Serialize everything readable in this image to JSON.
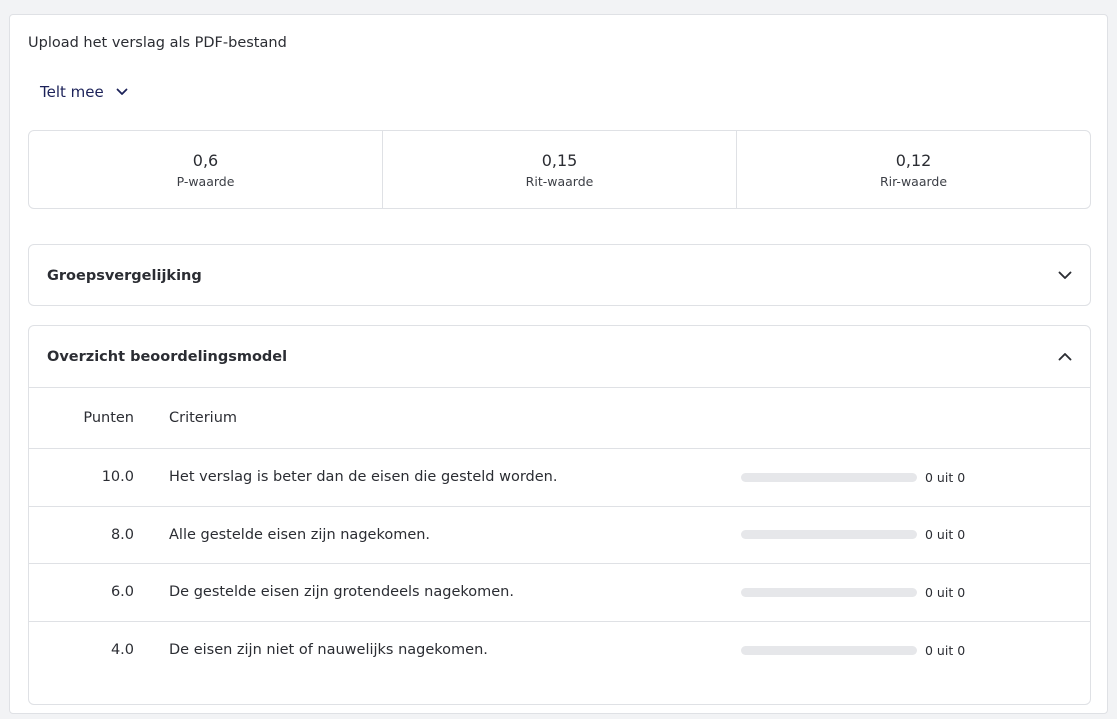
{
  "instruction": "Upload het verslag als PDF-bestand",
  "counts_toggle": {
    "label": "Telt mee",
    "icon": "chevron-down-icon"
  },
  "stats": [
    {
      "value": "0,6",
      "label": "P-waarde"
    },
    {
      "value": "0,15",
      "label": "Rit-waarde"
    },
    {
      "value": "0,12",
      "label": "Rir-waarde"
    }
  ],
  "group_comparison": {
    "title": "Groepsvergelijking",
    "expanded": false
  },
  "overview": {
    "title": "Overzicht beoordelingsmodel",
    "expanded": true,
    "columns": {
      "points": "Punten",
      "criterion": "Criterium"
    },
    "rows": [
      {
        "points": "10.0",
        "criterion": "Het verslag is beter dan de eisen die gesteld worden.",
        "count": "0 uit 0",
        "fraction": 0
      },
      {
        "points": "8.0",
        "criterion": "Alle gestelde eisen zijn nagekomen.",
        "count": "0 uit 0",
        "fraction": 0
      },
      {
        "points": "6.0",
        "criterion": "De gestelde eisen zijn grotendeels nagekomen.",
        "count": "0 uit 0",
        "fraction": 0
      },
      {
        "points": "4.0",
        "criterion": "De eisen zijn niet of nauwelijks nagekomen.",
        "count": "0 uit 0",
        "fraction": 0
      }
    ]
  },
  "colors": {
    "accent": "#1c2259",
    "border": "#dfe1e5",
    "bar_track": "#e6e7ea"
  }
}
